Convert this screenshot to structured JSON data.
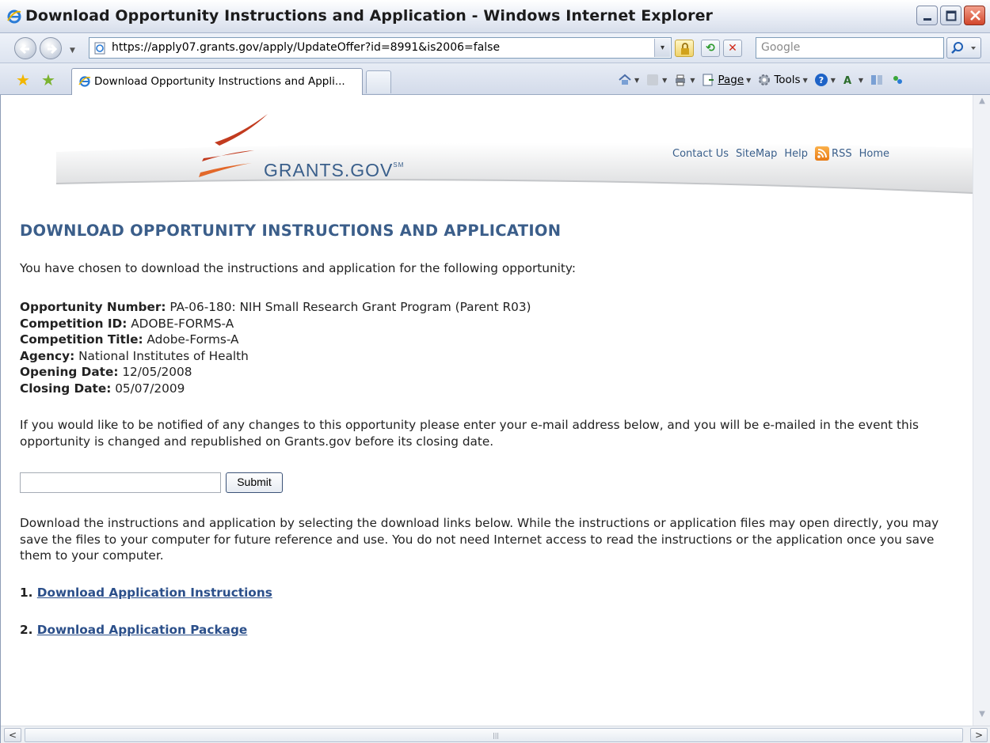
{
  "window": {
    "title": "Download Opportunity Instructions and Application - Windows Internet Explorer"
  },
  "address_bar": {
    "url": "https://apply07.grants.gov/apply/UpdateOffer?id=8991&is2006=false",
    "search_placeholder": "Google"
  },
  "tabs": [
    {
      "label": "Download Opportunity Instructions and Appli..."
    }
  ],
  "command_bar": {
    "page_label": "Page",
    "tools_label": "Tools"
  },
  "site": {
    "logo_text": "GRANTS.GOV",
    "logo_mark": "SM",
    "links": {
      "contact": "Contact Us",
      "sitemap": "SiteMap",
      "help": "Help",
      "rss": "RSS",
      "home": "Home"
    }
  },
  "page": {
    "title": "DOWNLOAD OPPORTUNITY INSTRUCTIONS AND APPLICATION",
    "intro": "You have chosen to download the instructions and application for the following opportunity:",
    "details": [
      {
        "label": "Opportunity Number:",
        "value": " PA-06-180: NIH Small Research Grant Program (Parent R03)"
      },
      {
        "label": "Competition ID:",
        "value": " ADOBE-FORMS-A"
      },
      {
        "label": "Competition Title:",
        "value": " Adobe-Forms-A"
      },
      {
        "label": "Agency:",
        "value": " National Institutes of Health"
      },
      {
        "label": "Opening Date:",
        "value": " 12/05/2008"
      },
      {
        "label": "Closing Date:",
        "value": " 05/07/2009"
      }
    ],
    "notify_text": "If you would like to be notified of any changes to this opportunity please enter your e-mail address below, and you will be e-mailed in the event this opportunity is changed and republished on Grants.gov before its closing date.",
    "email_value": "",
    "submit_label": "Submit",
    "download_text": "Download the instructions and application by selecting the download links below. While the instructions or application files may open directly, you may save the files to your computer for future reference and use. You do not need Internet access to read the instructions or the application once you save them to your computer.",
    "downloads": [
      {
        "number": "1. ",
        "label": "Download Application Instructions"
      },
      {
        "number": "2. ",
        "label": "Download Application Package"
      }
    ]
  },
  "colors": {
    "title_blue": "#3b5e8a",
    "link_blue": "#2b4f8a",
    "logo_orange": "#e2682a"
  }
}
